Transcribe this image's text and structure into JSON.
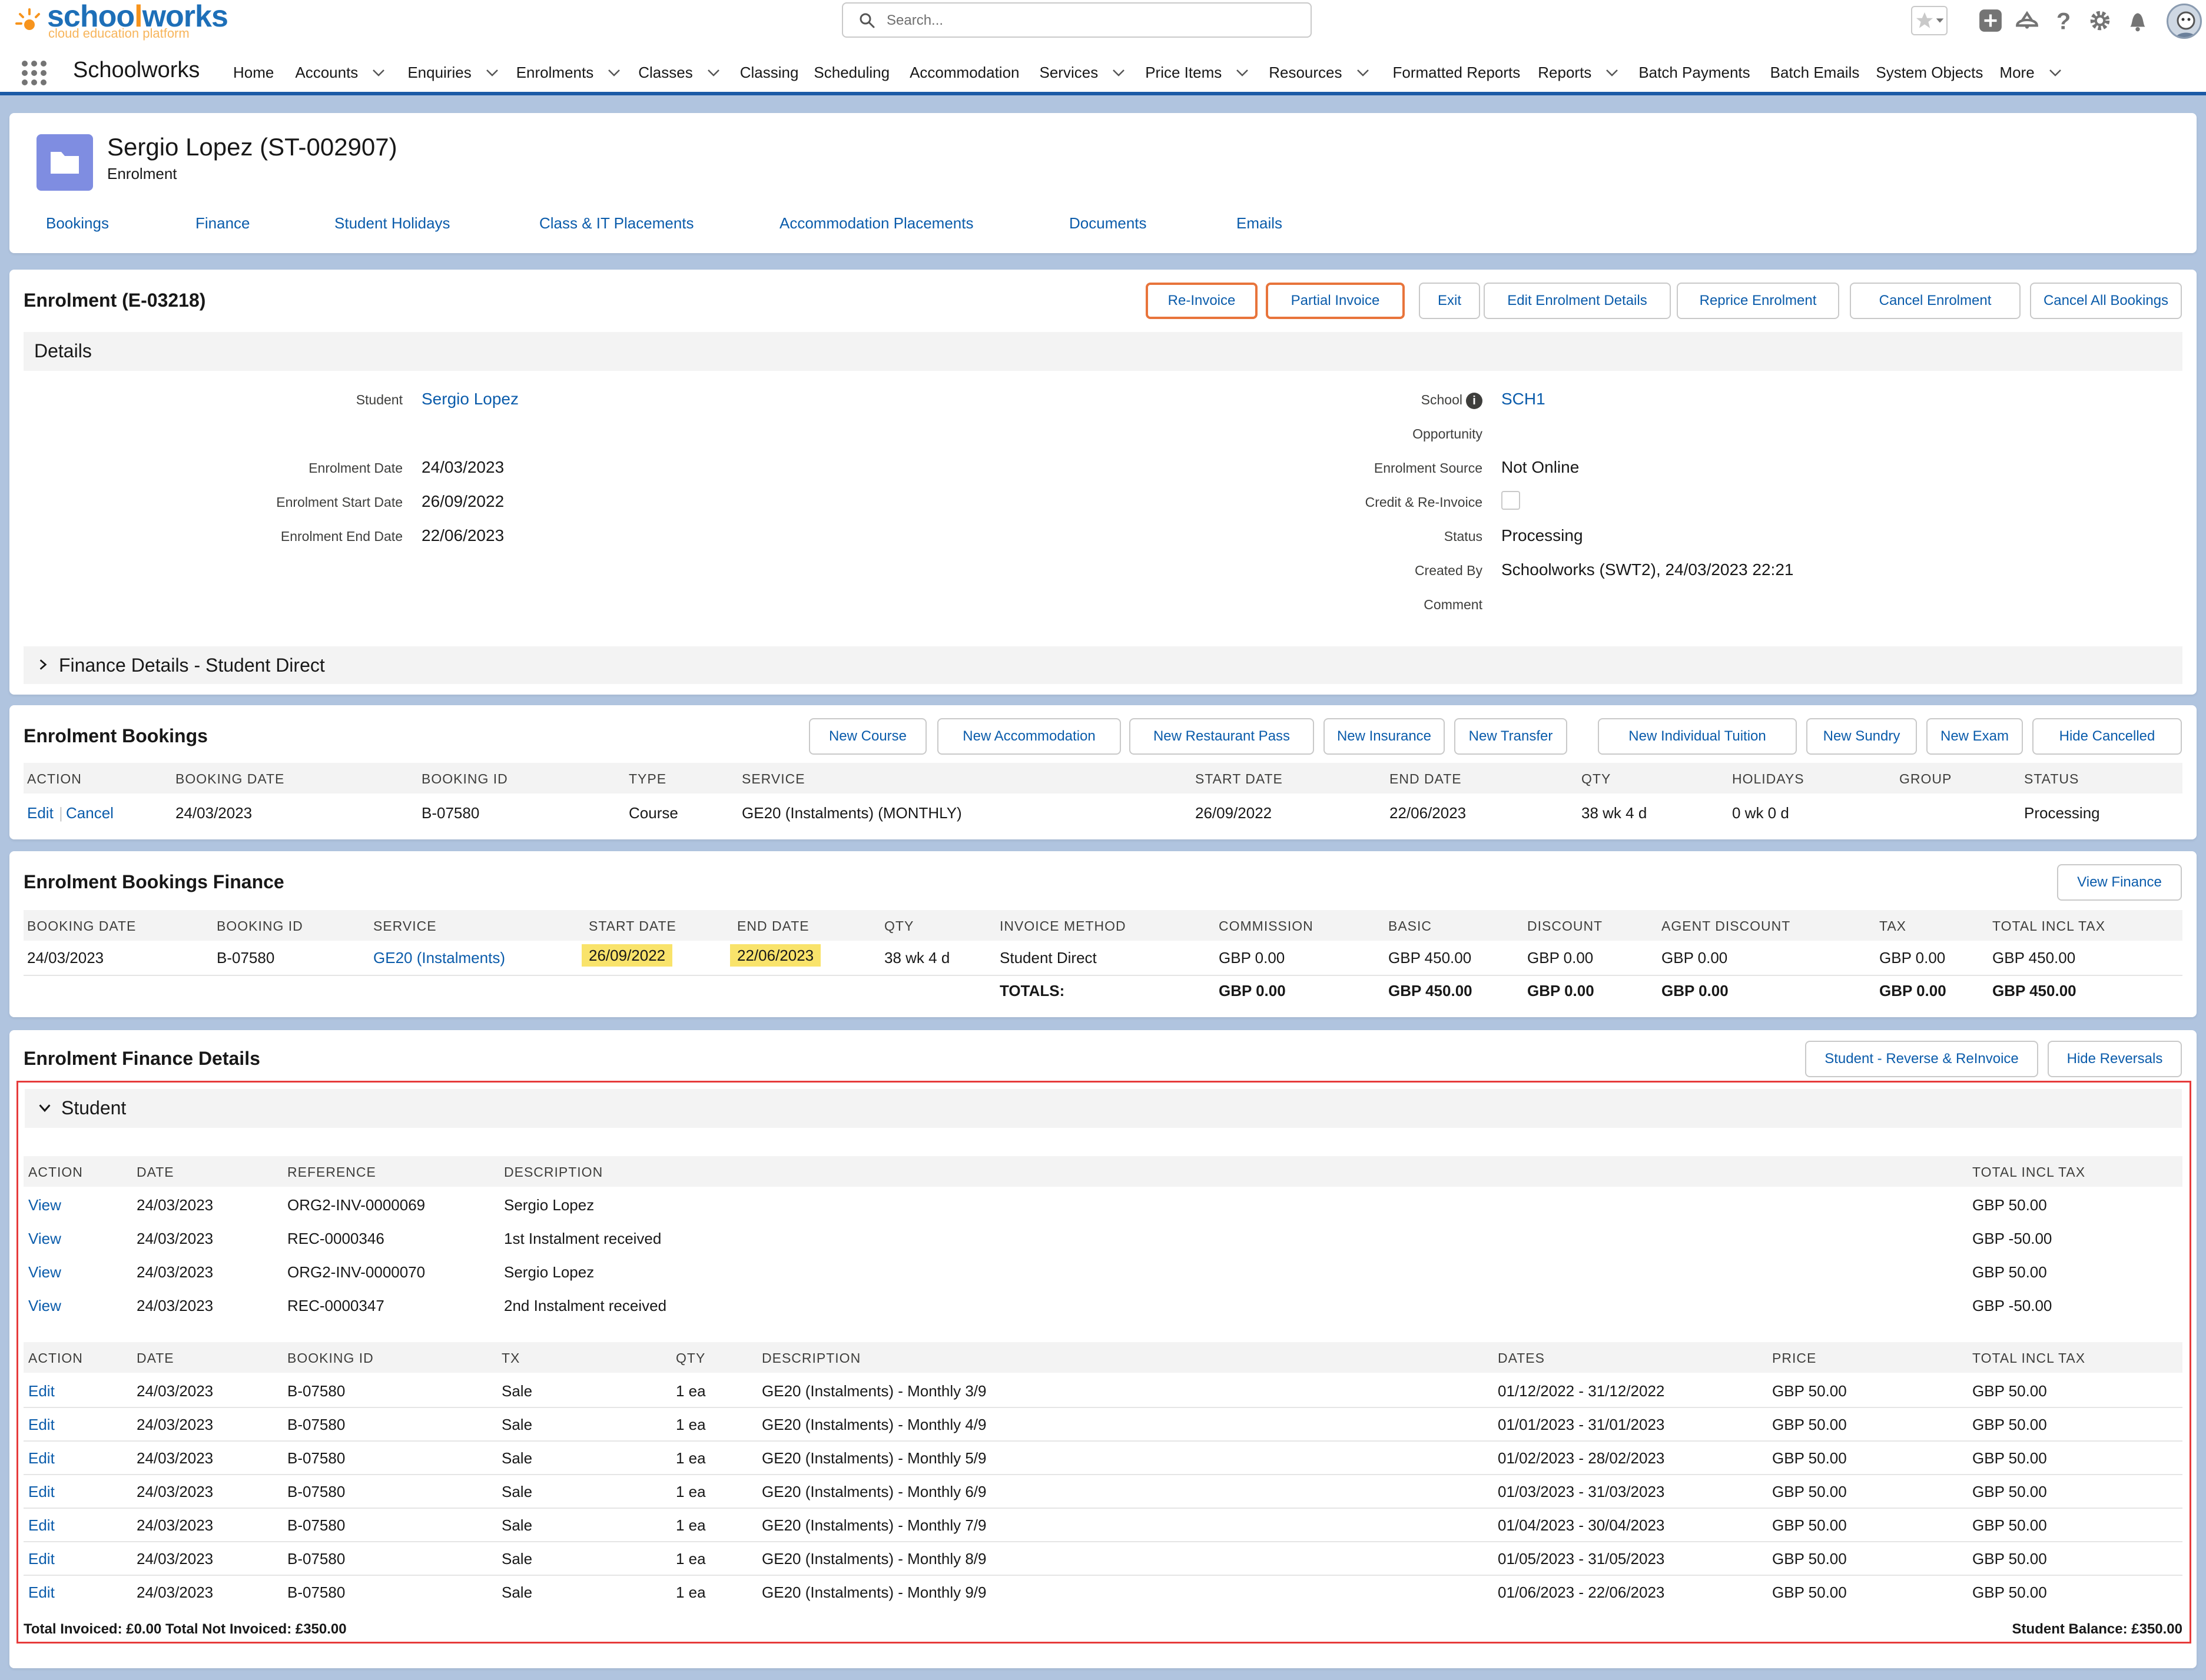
{
  "brand": {
    "name_a": "schoo",
    "name_b": "l",
    "name_c": "works",
    "tagline": "cloud education platform"
  },
  "search": {
    "placeholder": "Search..."
  },
  "nav": {
    "app_name": "Schoolworks",
    "items": [
      {
        "label": "Home",
        "chevron": false
      },
      {
        "label": "Accounts",
        "chevron": true
      },
      {
        "label": "Enquiries",
        "chevron": true
      },
      {
        "label": "Enrolments",
        "chevron": true
      },
      {
        "label": "Classes",
        "chevron": true
      },
      {
        "label": "Classing",
        "chevron": false
      },
      {
        "label": "Scheduling",
        "chevron": false
      },
      {
        "label": "Accommodation",
        "chevron": false
      },
      {
        "label": "Services",
        "chevron": true
      },
      {
        "label": "Price Items",
        "chevron": true
      },
      {
        "label": "Resources",
        "chevron": true
      },
      {
        "label": "Formatted Reports",
        "chevron": false
      },
      {
        "label": "Reports",
        "chevron": true
      },
      {
        "label": "Batch Payments",
        "chevron": false
      },
      {
        "label": "Batch Emails",
        "chevron": false
      },
      {
        "label": "System Objects",
        "chevron": false
      },
      {
        "label": "More",
        "chevron": true
      }
    ]
  },
  "record": {
    "title": "Sergio Lopez (ST-002907)",
    "subtitle": "Enrolment",
    "tabs": [
      "Bookings",
      "Finance",
      "Student Holidays",
      "Class & IT Placements",
      "Accommodation Placements",
      "Documents",
      "Emails"
    ]
  },
  "enrolment": {
    "title": "Enrolment (E-03218)",
    "buttons": [
      "Re-Invoice",
      "Partial Invoice",
      "Exit",
      "Edit Enrolment Details",
      "Reprice Enrolment",
      "Cancel Enrolment",
      "Cancel All Bookings"
    ],
    "details_heading": "Details",
    "left_fields": [
      {
        "label": "Student",
        "value": "Sergio Lopez",
        "link": true
      },
      {
        "label": "Enrolment Date",
        "value": "24/03/2023"
      },
      {
        "label": "Enrolment Start Date",
        "value": "26/09/2022"
      },
      {
        "label": "Enrolment End Date",
        "value": "22/06/2023"
      }
    ],
    "right_fields": [
      {
        "label": "School",
        "value": "SCH1",
        "link": true,
        "info": true
      },
      {
        "label": "Opportunity",
        "value": ""
      },
      {
        "label": "Enrolment Source",
        "value": "Not Online"
      },
      {
        "label": "Credit & Re-Invoice",
        "value": "",
        "checkbox": true,
        "checked": false
      },
      {
        "label": "Status",
        "value": "Processing"
      },
      {
        "label": "Created By",
        "value": "Schoolworks (SWT2), 24/03/2023 22:21"
      },
      {
        "label": "Comment",
        "value": ""
      }
    ],
    "finance_details_heading": "Finance Details - Student Direct"
  },
  "bookings": {
    "title": "Enrolment Bookings",
    "buttons": [
      "New Course",
      "New Accommodation",
      "New Restaurant Pass",
      "New Insurance",
      "New Transfer",
      "New Individual Tuition",
      "New Sundry",
      "New Exam",
      "Hide Cancelled"
    ],
    "columns": [
      "ACTION",
      "BOOKING DATE",
      "BOOKING ID",
      "TYPE",
      "SERVICE",
      "START DATE",
      "END DATE",
      "QTY",
      "HOLIDAYS",
      "GROUP",
      "STATUS"
    ],
    "rows": [
      {
        "action_edit": "Edit",
        "action_sep": "|",
        "action_cancel": "Cancel",
        "booking_date": "24/03/2023",
        "booking_id": "B-07580",
        "type": "Course",
        "service": "GE20 (Instalments) (MONTHLY)",
        "start": "26/09/2022",
        "end": "22/06/2023",
        "qty": "38 wk 4 d",
        "holidays": "0 wk 0 d",
        "group": "",
        "status": "Processing"
      }
    ]
  },
  "bookings_finance": {
    "title": "Enrolment Bookings Finance",
    "button": "View Finance",
    "columns": [
      "BOOKING DATE",
      "BOOKING ID",
      "SERVICE",
      "START DATE",
      "END DATE",
      "QTY",
      "INVOICE METHOD",
      "COMMISSION",
      "BASIC",
      "DISCOUNT",
      "AGENT DISCOUNT",
      "TAX",
      "TOTAL INCL TAX"
    ],
    "row": {
      "booking_date": "24/03/2023",
      "booking_id": "B-07580",
      "service": "GE20 (Instalments)",
      "start": "26/09/2022",
      "end": "22/06/2023",
      "qty": "38 wk 4 d",
      "invoice_method": "Student Direct",
      "commission": "GBP 0.00",
      "basic": "GBP 450.00",
      "discount": "GBP 0.00",
      "agent_discount": "GBP 0.00",
      "tax": "GBP 0.00",
      "total": "GBP 450.00"
    },
    "totals": {
      "label": "TOTALS:",
      "commission": "GBP 0.00",
      "basic": "GBP 450.00",
      "discount": "GBP 0.00",
      "agent_discount": "GBP 0.00",
      "tax": "GBP 0.00",
      "total": "GBP 450.00"
    }
  },
  "finance_details": {
    "title": "Enrolment Finance Details",
    "buttons": [
      "Student - Reverse & ReInvoice",
      "Hide Reversals"
    ],
    "section": "Student",
    "doc_columns": [
      "ACTION",
      "DATE",
      "REFERENCE",
      "DESCRIPTION",
      "TOTAL INCL TAX"
    ],
    "docs": [
      {
        "action": "View",
        "date": "24/03/2023",
        "reference": "ORG2-INV-0000069",
        "description": "Sergio Lopez",
        "total": "GBP 50.00"
      },
      {
        "action": "View",
        "date": "24/03/2023",
        "reference": "REC-0000346",
        "description": "1st Instalment received",
        "total": "GBP -50.00"
      },
      {
        "action": "View",
        "date": "24/03/2023",
        "reference": "ORG2-INV-0000070",
        "description": "Sergio Lopez",
        "total": "GBP 50.00"
      },
      {
        "action": "View",
        "date": "24/03/2023",
        "reference": "REC-0000347",
        "description": "2nd Instalment received",
        "total": "GBP -50.00"
      }
    ],
    "line_columns": [
      "ACTION",
      "DATE",
      "BOOKING ID",
      "TX",
      "QTY",
      "DESCRIPTION",
      "DATES",
      "PRICE",
      "TOTAL INCL TAX"
    ],
    "lines": [
      {
        "action": "Edit",
        "date": "24/03/2023",
        "booking_id": "B-07580",
        "tx": "Sale",
        "qty": "1 ea",
        "description": "GE20 (Instalments) - Monthly 3/9",
        "dates": "01/12/2022 - 31/12/2022",
        "price": "GBP 50.00",
        "total": "GBP 50.00"
      },
      {
        "action": "Edit",
        "date": "24/03/2023",
        "booking_id": "B-07580",
        "tx": "Sale",
        "qty": "1 ea",
        "description": "GE20 (Instalments) - Monthly 4/9",
        "dates": "01/01/2023 - 31/01/2023",
        "price": "GBP 50.00",
        "total": "GBP 50.00"
      },
      {
        "action": "Edit",
        "date": "24/03/2023",
        "booking_id": "B-07580",
        "tx": "Sale",
        "qty": "1 ea",
        "description": "GE20 (Instalments) - Monthly 5/9",
        "dates": "01/02/2023 - 28/02/2023",
        "price": "GBP 50.00",
        "total": "GBP 50.00"
      },
      {
        "action": "Edit",
        "date": "24/03/2023",
        "booking_id": "B-07580",
        "tx": "Sale",
        "qty": "1 ea",
        "description": "GE20 (Instalments) - Monthly 6/9",
        "dates": "01/03/2023 - 31/03/2023",
        "price": "GBP 50.00",
        "total": "GBP 50.00"
      },
      {
        "action": "Edit",
        "date": "24/03/2023",
        "booking_id": "B-07580",
        "tx": "Sale",
        "qty": "1 ea",
        "description": "GE20 (Instalments) - Monthly 7/9",
        "dates": "01/04/2023 - 30/04/2023",
        "price": "GBP 50.00",
        "total": "GBP 50.00"
      },
      {
        "action": "Edit",
        "date": "24/03/2023",
        "booking_id": "B-07580",
        "tx": "Sale",
        "qty": "1 ea",
        "description": "GE20 (Instalments) - Monthly 8/9",
        "dates": "01/05/2023 - 31/05/2023",
        "price": "GBP 50.00",
        "total": "GBP 50.00"
      },
      {
        "action": "Edit",
        "date": "24/03/2023",
        "booking_id": "B-07580",
        "tx": "Sale",
        "qty": "1 ea",
        "description": "GE20 (Instalments) - Monthly 9/9",
        "dates": "01/06/2023 - 22/06/2023",
        "price": "GBP 50.00",
        "total": "GBP 50.00"
      }
    ],
    "footer_left": "Total Invoiced: £0.00 Total Not Invoiced: £350.00",
    "footer_right": "Student Balance: £350.00"
  },
  "colors": {
    "link": "#0b5cab",
    "highlight_border": "#e8743b",
    "date_highlight": "#f9e36b",
    "red_outline": "#e63b3b",
    "nav_accent": "#1b5aa6",
    "record_icon": "#7f8de1"
  },
  "icons": [
    "search-icon",
    "favorites-star-icon",
    "add-icon",
    "trailhead-icon",
    "help-icon",
    "setup-gear-icon",
    "notifications-bell-icon",
    "avatar",
    "app-launcher-icon",
    "folder-icon",
    "info-icon",
    "chevron-right-icon",
    "chevron-down-icon"
  ]
}
